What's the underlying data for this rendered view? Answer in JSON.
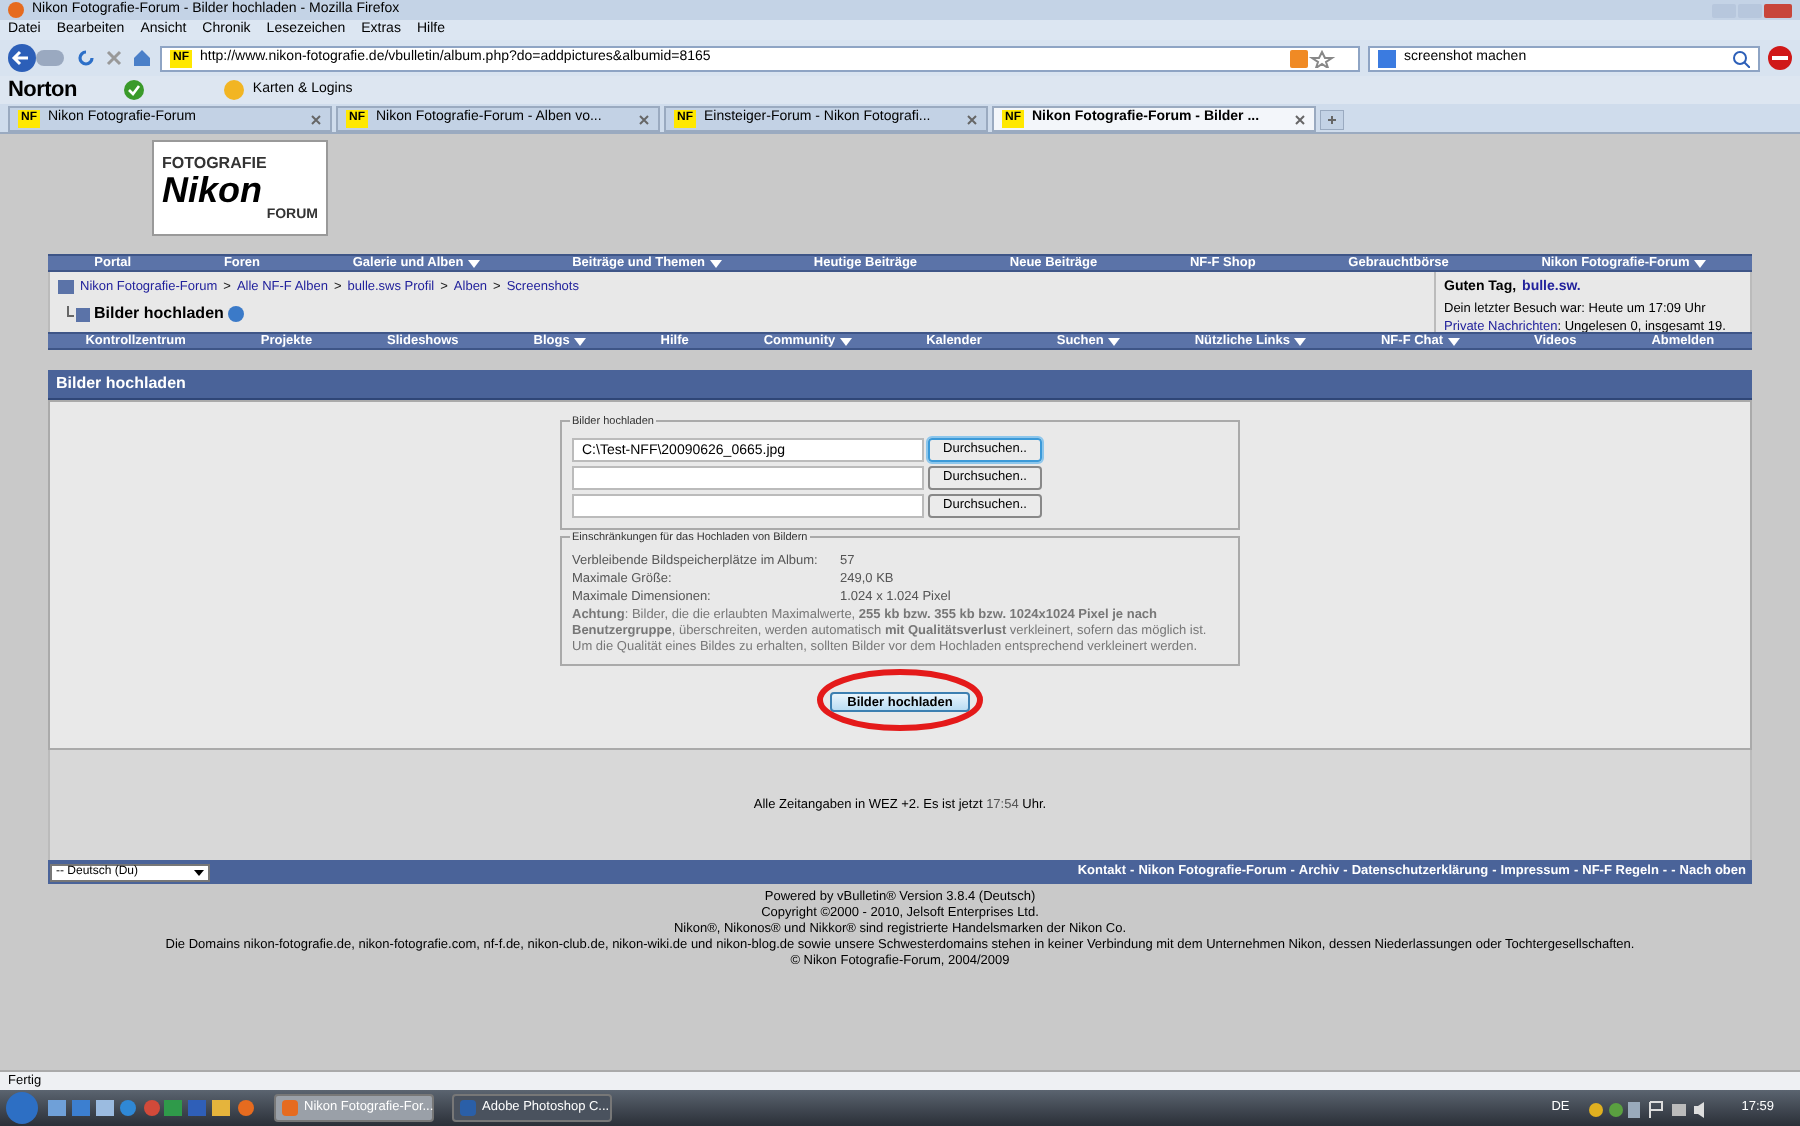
{
  "window": {
    "title": "Nikon Fotografie-Forum - Bilder hochladen - Mozilla Firefox"
  },
  "menu": [
    "Datei",
    "Bearbeiten",
    "Ansicht",
    "Chronik",
    "Lesezeichen",
    "Extras",
    "Hilfe"
  ],
  "address": {
    "favicon": "NF",
    "url": "http://www.nikon-fotografie.de/vbulletin/album.php?do=addpictures&albumid=8165"
  },
  "search": {
    "value": "screenshot machen"
  },
  "toolbar": {
    "brand": "Norton",
    "logins": "Karten & Logins"
  },
  "tabs": [
    {
      "favicon": "NF",
      "label": "Nikon Fotografie-Forum",
      "selected": false
    },
    {
      "favicon": "NF",
      "label": "Nikon Fotografie-Forum - Alben vo...",
      "selected": false
    },
    {
      "favicon": "NF",
      "label": "Einsteiger-Forum - Nikon Fotografi...",
      "selected": false
    },
    {
      "favicon": "NF",
      "label": "Nikon Fotografie-Forum - Bilder ...",
      "selected": true
    }
  ],
  "logo": {
    "line1": "FOTOGRAFIE",
    "line2": "Nikon",
    "line3": "FORUM"
  },
  "navbar_top": [
    {
      "label": "Portal",
      "dropdown": false
    },
    {
      "label": "Foren",
      "dropdown": false
    },
    {
      "label": "Galerie und Alben",
      "dropdown": true
    },
    {
      "label": "Beiträge und Themen",
      "dropdown": true
    },
    {
      "label": "Heutige Beiträge",
      "dropdown": false
    },
    {
      "label": "Neue Beiträge",
      "dropdown": false
    },
    {
      "label": "NF-F Shop",
      "dropdown": false
    },
    {
      "label": "Gebrauchtbörse",
      "dropdown": false
    },
    {
      "label": "Nikon Fotografie-Forum",
      "dropdown": true
    }
  ],
  "breadcrumb": [
    {
      "label": "Nikon Fotografie-Forum"
    },
    {
      "separator": ">",
      "label": "Alle NF-F Alben"
    },
    {
      "separator": ">",
      "label": "bulle.sws Profil"
    },
    {
      "separator": ">",
      "label": "Alben"
    },
    {
      "separator": ">",
      "label": "Screenshots"
    }
  ],
  "page_title": "Bilder hochladen",
  "welcome": {
    "greeting": "Guten Tag,",
    "user": "bulle.sw.",
    "last_visit": "Dein letzter Besuch war: Heute um 17:09 Uhr",
    "pm_link": "Private Nachrichten",
    "pm_text": ": Ungelesen 0, insgesamt 19."
  },
  "navbar_bottom": [
    {
      "label": "Kontrollzentrum",
      "dropdown": false
    },
    {
      "label": "Projekte",
      "dropdown": false
    },
    {
      "label": "Slideshows",
      "dropdown": false
    },
    {
      "label": "Blogs",
      "dropdown": true
    },
    {
      "label": "Hilfe",
      "dropdown": false
    },
    {
      "label": "Community",
      "dropdown": true
    },
    {
      "label": "Kalender",
      "dropdown": false
    },
    {
      "label": "Suchen",
      "dropdown": true
    },
    {
      "label": "Nützliche Links",
      "dropdown": true
    },
    {
      "label": "NF-F Chat",
      "dropdown": true
    },
    {
      "label": "Videos",
      "dropdown": false
    },
    {
      "label": "Abmelden",
      "dropdown": false
    }
  ],
  "section_title": "Bilder hochladen",
  "upload": {
    "legend": "Bilder hochladen",
    "files": [
      {
        "value": "C:\\Test-NFF\\20090626_0665.jpg",
        "browse": "Durchsuchen..",
        "focused": true
      },
      {
        "browse": "Durchsuchen..",
        "focused": false
      },
      {
        "browse": "Durchsuchen..",
        "focused": false
      }
    ]
  },
  "restrictions": {
    "legend": "Einschränkungen für das Hochladen von Bildern",
    "rows": [
      {
        "label": "Verbleibende Bildspeicherplätze im Album:",
        "value": "57"
      },
      {
        "label": "Maximale Größe:",
        "value": "249,0 KB"
      },
      {
        "label": "Maximale Dimensionen:",
        "value": "1.024 x 1.024 Pixel"
      }
    ],
    "notice": "**Achtung**: Bilder, die die erlaubten Maximalwerte, **255 kb bzw. 355 kb bzw. 1024x1024 Pixel je nach Benutzergruppe**, überschreiten, werden automatisch **mit Qualitätsverlust** verkleinert, sofern das möglich ist. Um die Qualität eines Bildes zu erhalten, sollten Bilder vor dem Hochladen entsprechend verkleinert werden."
  },
  "submit": "Bilder hochladen",
  "timezone": {
    "text": "Alle Zeitangaben in WEZ +2. Es ist jetzt",
    "time": "17:54",
    "suffix": "Uhr."
  },
  "language": "-- Deutsch (Du)",
  "footer_links": [
    "Kontakt",
    "-",
    "Nikon Fotografie-Forum",
    "-",
    "Archiv",
    "-",
    "Datenschutzerklärung",
    "-",
    "Impressum",
    "-",
    "NF-F Regeln",
    "-",
    "-",
    "Nach oben"
  ],
  "footer_lines": [
    "Powered by vBulletin® Version 3.8.4 (Deutsch)",
    "Copyright ©2000 - 2010, Jelsoft Enterprises Ltd.",
    "Nikon®, Nikonos® und Nikkor® sind registrierte Handelsmarken der Nikon Co.",
    "Die Domains nikon-fotografie.de, nikon-fotografie.com, nf-f.de, nikon-club.de, nikon-wiki.de und nikon-blog.de sowie unsere Schwesterdomains stehen in keiner Verbindung mit dem Unternehmen Nikon, dessen Niederlassungen oder Tochtergesellschaften.",
    "© Nikon Fotografie-Forum, 2004/2009"
  ],
  "status_bar": "Fertig",
  "taskbar": {
    "windows": [
      {
        "label": "Nikon Fotografie-For...",
        "selected": true
      },
      {
        "label": "Adobe Photoshop C...",
        "selected": false
      }
    ],
    "language": "DE",
    "clock": "17:59"
  }
}
